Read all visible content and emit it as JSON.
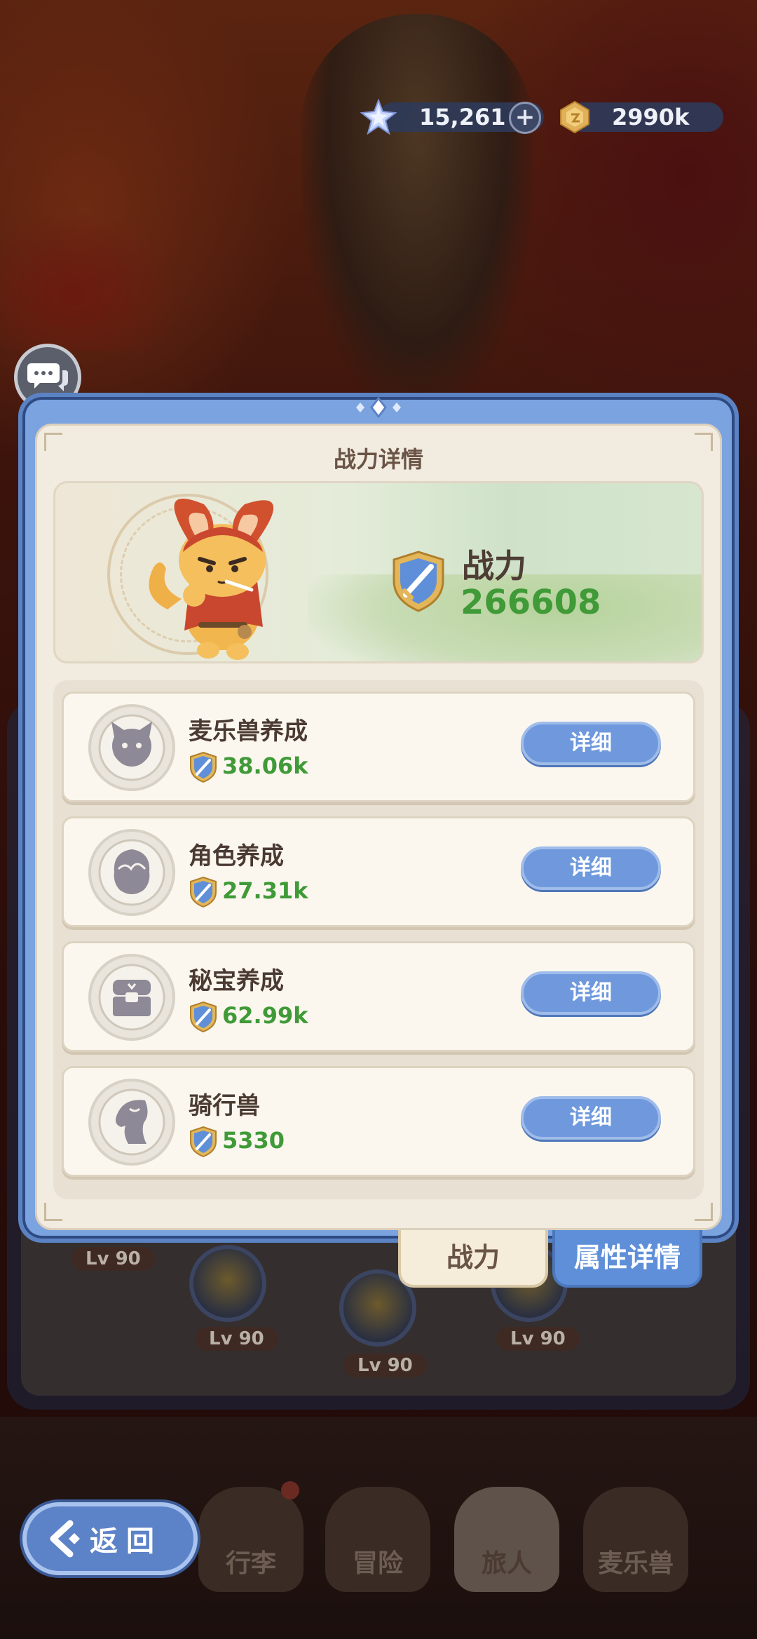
{
  "hud": {
    "gems": "15,261",
    "gold": "2990k",
    "plus_icon": "plus-icon",
    "star_icon": "star-crystal-icon",
    "coin_icon": "gold-coin-icon"
  },
  "modal": {
    "title": "战力详情",
    "power_label": "战力",
    "power_value": "266608",
    "rows": [
      {
        "label": "麦乐兽养成",
        "value": "38.06k",
        "button": "详细",
        "icon": "cat-head-icon"
      },
      {
        "label": "角色养成",
        "value": "27.31k",
        "button": "详细",
        "icon": "character-head-icon"
      },
      {
        "label": "秘宝养成",
        "value": "62.99k",
        "button": "详细",
        "icon": "treasure-chest-icon"
      },
      {
        "label": "骑行兽",
        "value": "5330",
        "button": "详细",
        "icon": "horse-head-icon"
      }
    ],
    "tabs": {
      "power": "战力",
      "attributes": "属性详情"
    }
  },
  "background": {
    "levels": [
      "Lv 90",
      "Lv 90",
      "Lv 90",
      "Lv 90"
    ]
  },
  "nav": {
    "tabs": [
      "行李",
      "冒险",
      "旅人",
      "麦乐兽"
    ],
    "active": "旅人"
  },
  "back": {
    "label": "返回"
  },
  "colors": {
    "accent_blue": "#6f99dc",
    "power_green": "#3f9a37",
    "paper": "#f1ebe0",
    "frame": "#7aa3e0"
  }
}
